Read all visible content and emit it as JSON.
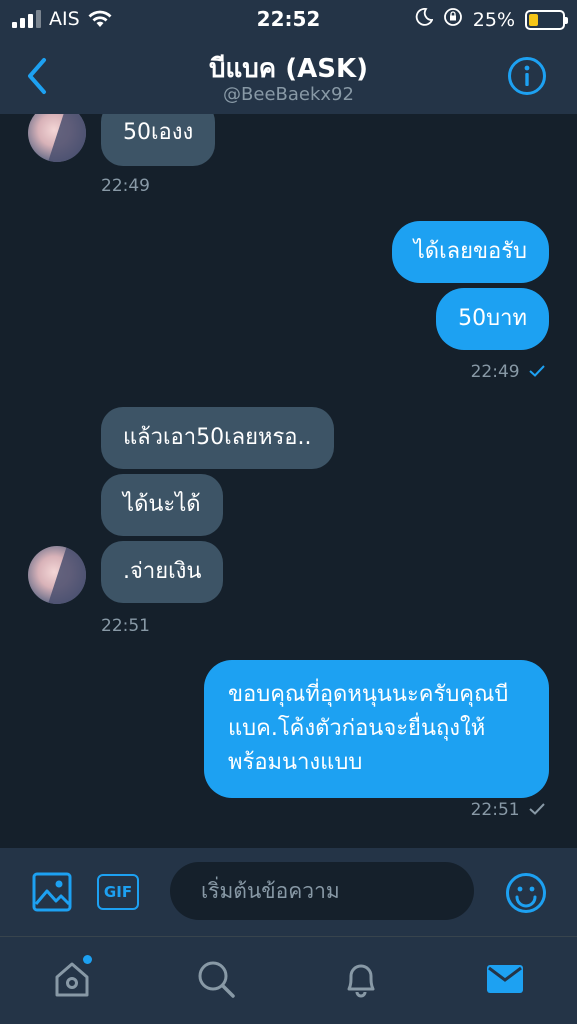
{
  "status_bar": {
    "carrier": "AIS",
    "time": "22:52",
    "battery": "25%",
    "battery_level": 0.25
  },
  "header": {
    "title": "บีแบค (ASK)",
    "handle": "@BeeBaekx92"
  },
  "messages": {
    "m1": "50เองง",
    "ts1": "22:49",
    "m2": "ได้เลยขอรับ",
    "m3": "50บาท",
    "ts2": "22:49",
    "m4": "แล้วเอา50เลยหรอ..",
    "m5": "ได้นะได้",
    "m6": ".จ่ายเงิน",
    "ts3": "22:51",
    "m7_line1": "ขอบคุณที่อุดหนุนนะครับคุณบี",
    "m7_line2": "แบค.โค้งตัวก่อนจะยื่นถุงให้",
    "m7_line3": "พร้อมนางแบบ",
    "ts4": "22:51"
  },
  "composer": {
    "gif_label": "GIF",
    "placeholder": "เริ่มต้นข้อความ"
  },
  "colors": {
    "accent": "#1da1f2",
    "background": "#15202b",
    "bar": "#243447",
    "incoming_bubble": "#3d5466",
    "muted": "#8899a6"
  },
  "icons": {
    "back": "chevron-left-icon",
    "info": "info-icon",
    "image": "image-icon",
    "emoji": "emoji-icon",
    "home": "home-icon",
    "search": "search-icon",
    "notifications": "bell-icon",
    "messages": "mail-icon"
  }
}
